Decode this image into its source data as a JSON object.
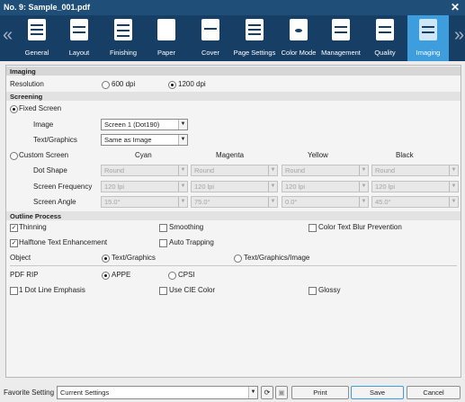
{
  "window": {
    "title": "No. 9: Sample_001.pdf",
    "close_glyph": "✕"
  },
  "nav": {
    "prev_glyph": "«",
    "next_glyph": "»"
  },
  "tabs": [
    {
      "label": "General",
      "icon": "general-icon"
    },
    {
      "label": "Layout",
      "icon": "layout-icon"
    },
    {
      "label": "Finishing",
      "icon": "finishing-icon"
    },
    {
      "label": "Paper",
      "icon": "paper-icon"
    },
    {
      "label": "Cover",
      "icon": "cover-icon"
    },
    {
      "label": "Page Settings",
      "icon": "page-settings-icon"
    },
    {
      "label": "Color Mode",
      "icon": "color-mode-icon"
    },
    {
      "label": "Management",
      "icon": "management-icon"
    },
    {
      "label": "Quality",
      "icon": "quality-icon"
    },
    {
      "label": "Imaging",
      "icon": "imaging-icon",
      "active": true
    }
  ],
  "imaging": {
    "header": "Imaging",
    "resolution_label": "Resolution",
    "res_600": "600 dpi",
    "res_1200": "1200 dpi",
    "selected_resolution": "1200 dpi"
  },
  "screening": {
    "header": "Screening",
    "fixed_screen": "Fixed Screen",
    "image_label": "Image",
    "image_value": "Screen 1 (Dot190)",
    "text_graphics_label": "Text/Graphics",
    "text_graphics_value": "Same as Image",
    "custom_screen": "Custom Screen",
    "columns": [
      "Cyan",
      "Magenta",
      "Yellow",
      "Black"
    ],
    "dot_shape_label": "Dot Shape",
    "screen_frequency_label": "Screen Frequency",
    "screen_angle_label": "Screen Angle",
    "dot_shape": [
      "Round",
      "Round",
      "Round",
      "Round"
    ],
    "screen_frequency": [
      "120 lpi",
      "120 lpi",
      "120 lpi",
      "120 lpi"
    ],
    "screen_angle": [
      "15.0°",
      "75.0°",
      "0.0°",
      "45.0°"
    ]
  },
  "outline": {
    "header": "Outline Process",
    "thinning": "Thinning",
    "smoothing": "Smoothing",
    "color_text_blur": "Color Text Blur Prevention",
    "halftone_text": "Halftone Text Enhancement",
    "auto_trapping": "Auto Trapping",
    "object_label": "Object",
    "object_text_graphics": "Text/Graphics",
    "object_text_graphics_image": "Text/Graphics/Image"
  },
  "pdf": {
    "pdf_rip_label": "PDF RIP",
    "appe": "APPE",
    "cpsi": "CPSI",
    "one_dot_line": "1 Dot Line Emphasis",
    "use_cie_color": "Use CIE Color",
    "glossy": "Glossy"
  },
  "footer": {
    "favorite_label": "Favorite Setting",
    "favorite_value": "Current Settings",
    "print": "Print",
    "save": "Save",
    "cancel": "Cancel"
  },
  "colors": {
    "title_bar": "#1f4e79",
    "toolbar": "#173e65",
    "active_tab": "#3d9ddd"
  }
}
